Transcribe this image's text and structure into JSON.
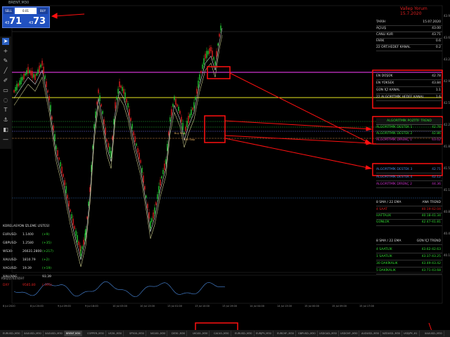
{
  "window": {
    "title": "BRENT,M30"
  },
  "trade_panel": {
    "sell_label": "SELL",
    "buy_label": "BUY",
    "lot": "0.01",
    "bid_prefix": "43",
    "bid_big": "71",
    "ask_prefix": "43",
    "ask_big": "73"
  },
  "brand": {
    "name": "Vallep Yorum",
    "date": "15.7.2020"
  },
  "info_panel": {
    "rows": [
      {
        "label": "TARİH",
        "value": "15.07.2020"
      },
      {
        "label": "AÇILIŞ",
        "value": "43.00"
      },
      {
        "label": "CANLI KUR",
        "value": "43.71"
      },
      {
        "label": "FARK",
        "value": "0.6"
      },
      {
        "label": "22 ORT.HEDEF KANAL",
        "value": "0.2"
      }
    ],
    "rows2": [
      {
        "label": "EN DÜŞÜK",
        "value": "42.78"
      },
      {
        "label": "EN YÜKSEK",
        "value": "43.84"
      },
      {
        "label": "GÜN İÇİ KANAL",
        "value": "1.1"
      },
      {
        "label": "22 ALGORİTMİK HEDEF KANAL",
        "value": "1.6"
      }
    ],
    "algo_title": "ALGORİTMİK POZİTİF TREND",
    "algo_rows": [
      {
        "label": "ALGORİTMİK DESTEK 1",
        "value": "42.78"
      },
      {
        "label": "ALGORİTMİK DESTEK 2",
        "value": "42.86"
      },
      {
        "label": "ALGORİTMİK DİRENÇ 1",
        "value": "43.02"
      }
    ],
    "algo_rows2": [
      {
        "label": "ALGORİTMİK DESTEK 3",
        "value": "42.71"
      },
      {
        "label": "ALGORİTMİK DESTEK 4",
        "value": "42.12"
      },
      {
        "label": "ALGORİTMİK DİRENÇ 2",
        "value": "44.36"
      }
    ],
    "sma_title_a": "8 SMA / 22 EMA",
    "sma_title_b": "ANA TREND",
    "sma_rows": [
      {
        "label": "4 SAAT",
        "value": "40.19-42.04"
      },
      {
        "label": "HAFTALIK",
        "value": "40.18-41.34"
      },
      {
        "label": "GÜNLÜK",
        "value": "42.47-41.81"
      }
    ],
    "intra_title_a": "8 SMA / 22 EMA",
    "intra_title_b": "GÜN İÇİ TREND",
    "intra_rows": [
      {
        "label": "4 SAATLİK",
        "value": "43.62-42.63"
      },
      {
        "label": "1 SAATLİK",
        "value": "43.37-43.25"
      },
      {
        "label": "30 DAKİKALIK",
        "value": "43.49-43.42"
      },
      {
        "label": "5 DAKİKALIK",
        "value": "43.71-43.68"
      }
    ]
  },
  "correlation": {
    "title": "KORELASYON İZLEME LİSTESİ",
    "rows": [
      {
        "sym": "EURUSD-",
        "price": "1.1400",
        "chg": "(+9)",
        "color": "#33dd33"
      },
      {
        "sym": "GBPUSD-",
        "price": "1.2580",
        "chg": "(+35)",
        "color": "#33dd33"
      },
      {
        "sym": "WS30-",
        "price": "26631.2800",
        "chg": "(+217)",
        "color": "#33dd33"
      },
      {
        "sym": "XAUUSD-",
        "price": "1810.79",
        "chg": "(+2)",
        "color": "#33dd33"
      },
      {
        "sym": "XAGUSD-",
        "price": "19.39",
        "chg": "(+19)",
        "color": "#33dd33"
      },
      {
        "sym": "XAU/XAG",
        "price": "",
        "chg": "93.39",
        "color": "#dddddd"
      },
      {
        "sym": "DXY",
        "price": "9585.80",
        "chg": "(-305)",
        "color": "#e02020"
      }
    ]
  },
  "price_axis": [
    "43.95",
    "43.60",
    "43.25",
    "42.90",
    "42.55",
    "42.20",
    "41.85",
    "41.50",
    "41.15",
    "40.80",
    "40.45",
    "40.10"
  ],
  "date_axis": [
    "8 Jul 2020",
    "8 Jul 20:00",
    "9 Jul 09:00",
    "9 Jul 18:00",
    "10 Jul 03:00",
    "10 Jul 13:00",
    "13 Jul 01:00",
    "13 Jul 10:00",
    "13 Jul 19:00",
    "14 Jul 04:00",
    "14 Jul 13:00",
    "15 Jul 00:00",
    "15 Jul 09:00",
    "15 Jul 17:00"
  ],
  "indicator_label": "RSI(22) 63.6597",
  "chart_labels": {
    "buy_stop": "Buy Stop",
    "sell_stop": "Sell Stop"
  },
  "tabs": [
    "EURUSD-,M30",
    "XAUUSD-,M30",
    "XAGUSD-,M30",
    "BRENT,M30",
    "COPPER-,M30",
    "US30-,M30",
    "SP500-,M30",
    "NS100-,M30",
    "DE30-,M30",
    "UK100-,M30",
    "CAC40-,M30",
    "EURUSD-,M30",
    "EURJPY-,M30",
    "EURCHF-,M30",
    "GBPUSD-,M30",
    "USDCAD-,M30",
    "USDCHF-,M30",
    "AUDUSD-,M30",
    "NZDUSD-,M30",
    "USDJPY-,H1",
    "XAUUSD-,M30"
  ],
  "active_tab": 3,
  "colors": {
    "bull": "#22cc33",
    "bear": "#e02020",
    "magenta": "#cc33cc",
    "yellow": "#e8e820",
    "box": "#ff1010",
    "accent_blue": "#2151c0"
  }
}
